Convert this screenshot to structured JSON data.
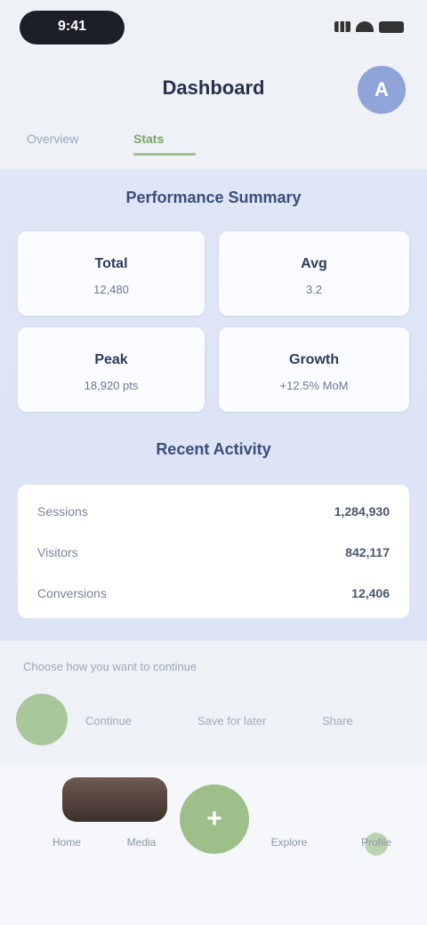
{
  "status_bar": {
    "time": "9:41"
  },
  "header": {
    "title": "Dashboard",
    "avatar_initial": "A"
  },
  "tabs": [
    {
      "label": "Overview",
      "active": false
    },
    {
      "label": "Stats",
      "active": true
    }
  ],
  "summary": {
    "heading": "Performance Summary",
    "stats": [
      {
        "label": "Total",
        "value": "12,480"
      },
      {
        "label": "Avg",
        "value": "3.2"
      },
      {
        "label": "Peak",
        "value": "18,920 pts"
      },
      {
        "label": "Growth",
        "value": "+12.5% MoM"
      }
    ]
  },
  "details": {
    "heading": "Recent Activity",
    "rows": [
      {
        "key": "Sessions",
        "value": "1,284,930"
      },
      {
        "key": "Visitors",
        "value": "842,117"
      },
      {
        "key": "Conversions",
        "value": "12,406"
      }
    ]
  },
  "section_hint": "Choose how you want to continue",
  "options": [
    "Continue",
    "Save for later",
    "Share"
  ],
  "bottom_nav": {
    "items": [
      "Home",
      "Media",
      "Explore",
      "Profile"
    ],
    "fab_icon": "plus-icon"
  },
  "colors": {
    "accent_green": "#9dc08a",
    "accent_blue": "#8fa4d8",
    "panel_bg": "#dbe3f5"
  }
}
